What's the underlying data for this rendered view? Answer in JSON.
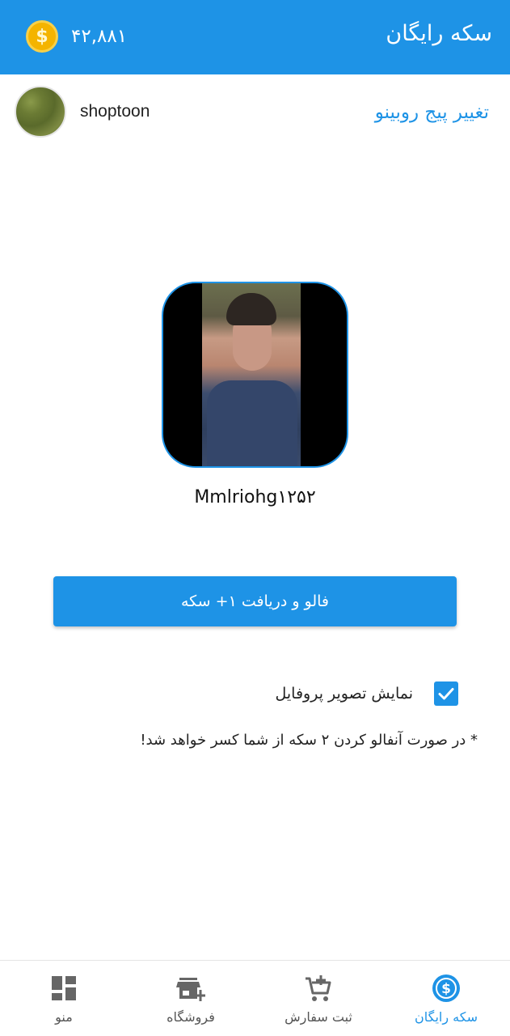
{
  "header": {
    "title": "سکه رایگان",
    "coin_balance": "۴۲,۸۸۱",
    "coin_symbol": "$",
    "accent_color": "#1e93e6"
  },
  "account": {
    "username": "shoptoon",
    "change_page_label": "تغییر پیج روبینو"
  },
  "target": {
    "username": "Mmlriohg۱۲۵۲"
  },
  "actions": {
    "follow_label": "فالو و دریافت ۱+ سکه"
  },
  "options": {
    "show_profile_picture_label": "نمایش تصویر پروفایل",
    "show_profile_picture_checked": true
  },
  "note": "* در صورت آنفالو کردن ۲ سکه از شما کسر خواهد شد!",
  "bottom_nav": {
    "items": [
      {
        "label": "سکه رایگان",
        "icon": "dollar-coin-icon",
        "active": true
      },
      {
        "label": "ثبت سفارش",
        "icon": "cart-add-icon",
        "active": false
      },
      {
        "label": "فروشگاه",
        "icon": "store-add-icon",
        "active": false
      },
      {
        "label": "منو",
        "icon": "dashboard-icon",
        "active": false
      }
    ]
  }
}
